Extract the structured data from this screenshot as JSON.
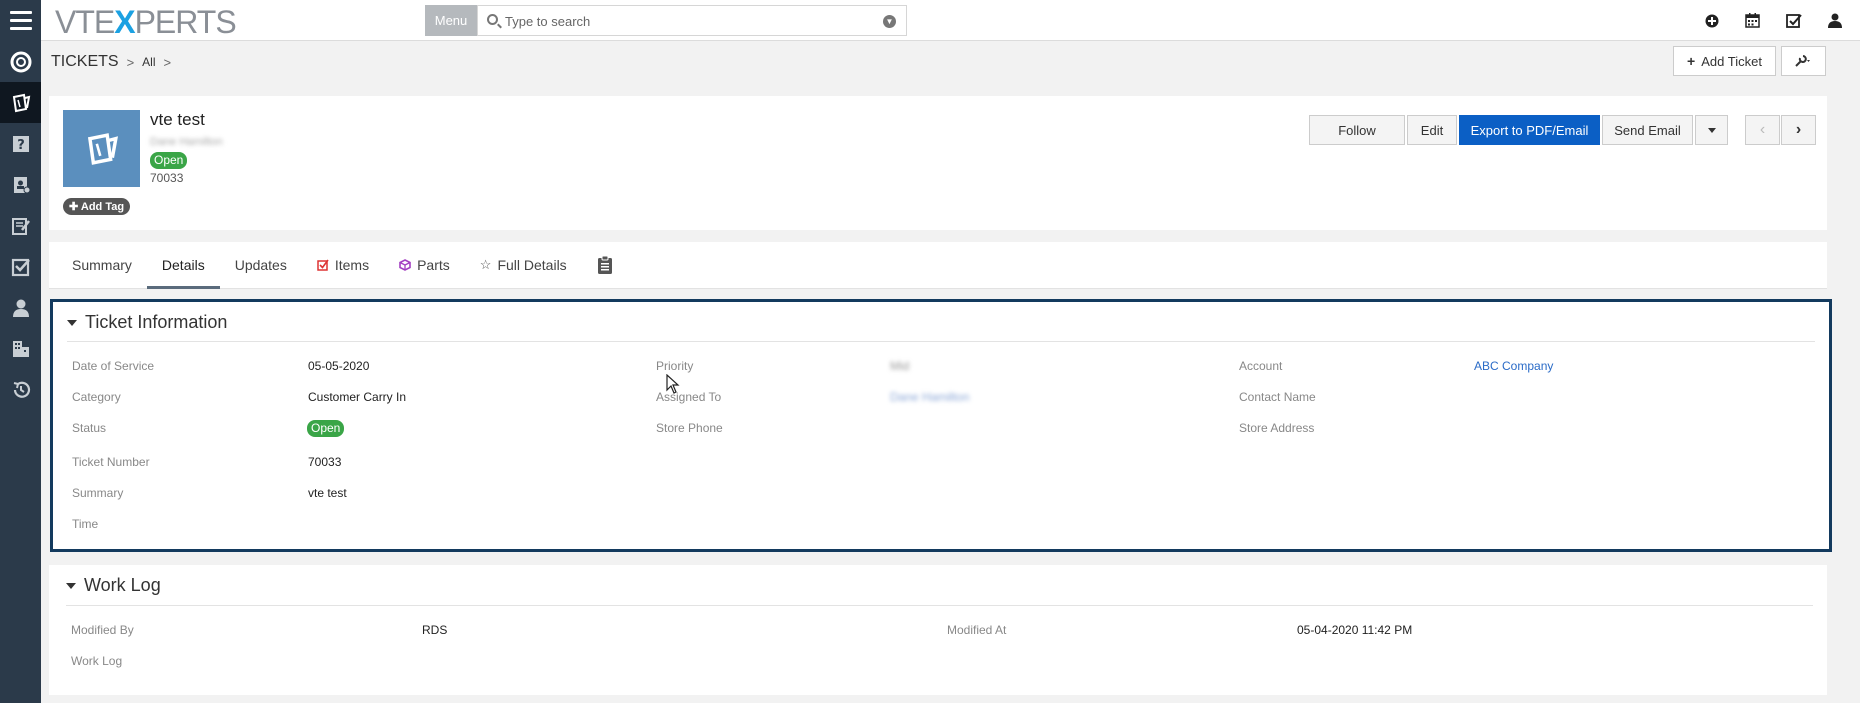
{
  "topbar": {
    "logo_prefix": "VTE",
    "logo_x": "X",
    "logo_suffix": "PERTS",
    "menu_label": "Menu",
    "search_placeholder": "Type to search",
    "icons": [
      "plus-circle-icon",
      "calendar-icon",
      "checkbox-icon",
      "user-icon"
    ]
  },
  "sidebar": {
    "items": [
      "support-icon",
      "tickets-icon",
      "help-icon",
      "contacts-icon",
      "notes-icon",
      "tasks-icon",
      "user-icon",
      "organization-icon",
      "history-icon"
    ],
    "active_index": 1
  },
  "breadcrumb": {
    "module": "TICKETS",
    "filter": "All"
  },
  "header_actions": {
    "add_ticket": "Add Ticket"
  },
  "record": {
    "title": "vte test",
    "owner": "Dane Hamilton",
    "status": "Open",
    "number": "70033",
    "add_tag": "Add Tag",
    "buttons": {
      "follow": "Follow",
      "edit": "Edit",
      "export": "Export to PDF/Email",
      "send_email": "Send Email"
    }
  },
  "tabs": [
    {
      "label": "Summary",
      "icon": ""
    },
    {
      "label": "Details",
      "icon": ""
    },
    {
      "label": "Updates",
      "icon": ""
    },
    {
      "label": "Items",
      "icon": "checkbox-icon"
    },
    {
      "label": "Parts",
      "icon": "box-icon"
    },
    {
      "label": "Full Details",
      "icon": "star-icon"
    }
  ],
  "ticket_info": {
    "title": "Ticket Information",
    "fields": {
      "date_of_service": {
        "label": "Date of Service",
        "value": "05-05-2020"
      },
      "category": {
        "label": "Category",
        "value": "Customer Carry In"
      },
      "status": {
        "label": "Status",
        "value": "Open"
      },
      "ticket_number": {
        "label": "Ticket Number",
        "value": "70033"
      },
      "summary": {
        "label": "Summary",
        "value": "vte test"
      },
      "time": {
        "label": "Time",
        "value": ""
      },
      "priority": {
        "label": "Priority",
        "value": "Mid"
      },
      "assigned_to": {
        "label": "Assigned To",
        "value": "Dane Hamilton"
      },
      "store_phone": {
        "label": "Store Phone",
        "value": ""
      },
      "account": {
        "label": "Account",
        "value": "ABC Company"
      },
      "contact_name": {
        "label": "Contact Name",
        "value": ""
      },
      "store_address": {
        "label": "Store Address",
        "value": ""
      }
    }
  },
  "work_log": {
    "title": "Work Log",
    "fields": {
      "modified_by": {
        "label": "Modified By",
        "value": "RDS"
      },
      "modified_at": {
        "label": "Modified At",
        "value": "05-04-2020 11:42 PM"
      },
      "work_log": {
        "label": "Work Log",
        "value": ""
      }
    }
  },
  "colors": {
    "sidebar": "#2b3a4a",
    "primary_button": "#0b5fc5",
    "status_open": "#3aa547",
    "block_border": "#133a5e",
    "link": "#2a6bc7"
  }
}
